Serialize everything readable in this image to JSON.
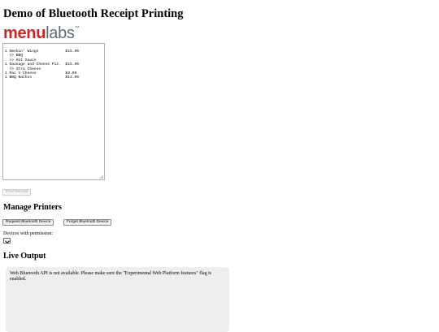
{
  "page": {
    "title": "Demo of Bluetooth Receipt Printing"
  },
  "logo": {
    "part1": "menu",
    "part2": "labs",
    "tm": "™",
    "colors": {
      "menu": "#c62828",
      "labs": "#5f6b73"
    }
  },
  "receipt": {
    "lines": [
      "1 Smokin' Wings            $15.99",
      "  >> BBQ",
      "  >> Hot Sauce",
      "1 Sausage and Cheese Piz.  $15.99",
      "  >> Xtra Cheese",
      "1 Mac n Cheese             $3.99",
      "1 BBQ Nachos               $14.99"
    ]
  },
  "print_button": {
    "label": "Print Receipt",
    "disabled": true
  },
  "printers": {
    "heading": "Manage Printers",
    "request_label": "Request Bluetooth Device",
    "forget_label": "Forget Bluetooth Device",
    "devices_label": "Devices with permission:",
    "devices_selected": ""
  },
  "live": {
    "heading": "Live Output",
    "message": "Web Bluetooth API is not available. Please make sure the \"Experimental Web Platform features\" flag is enabled."
  }
}
